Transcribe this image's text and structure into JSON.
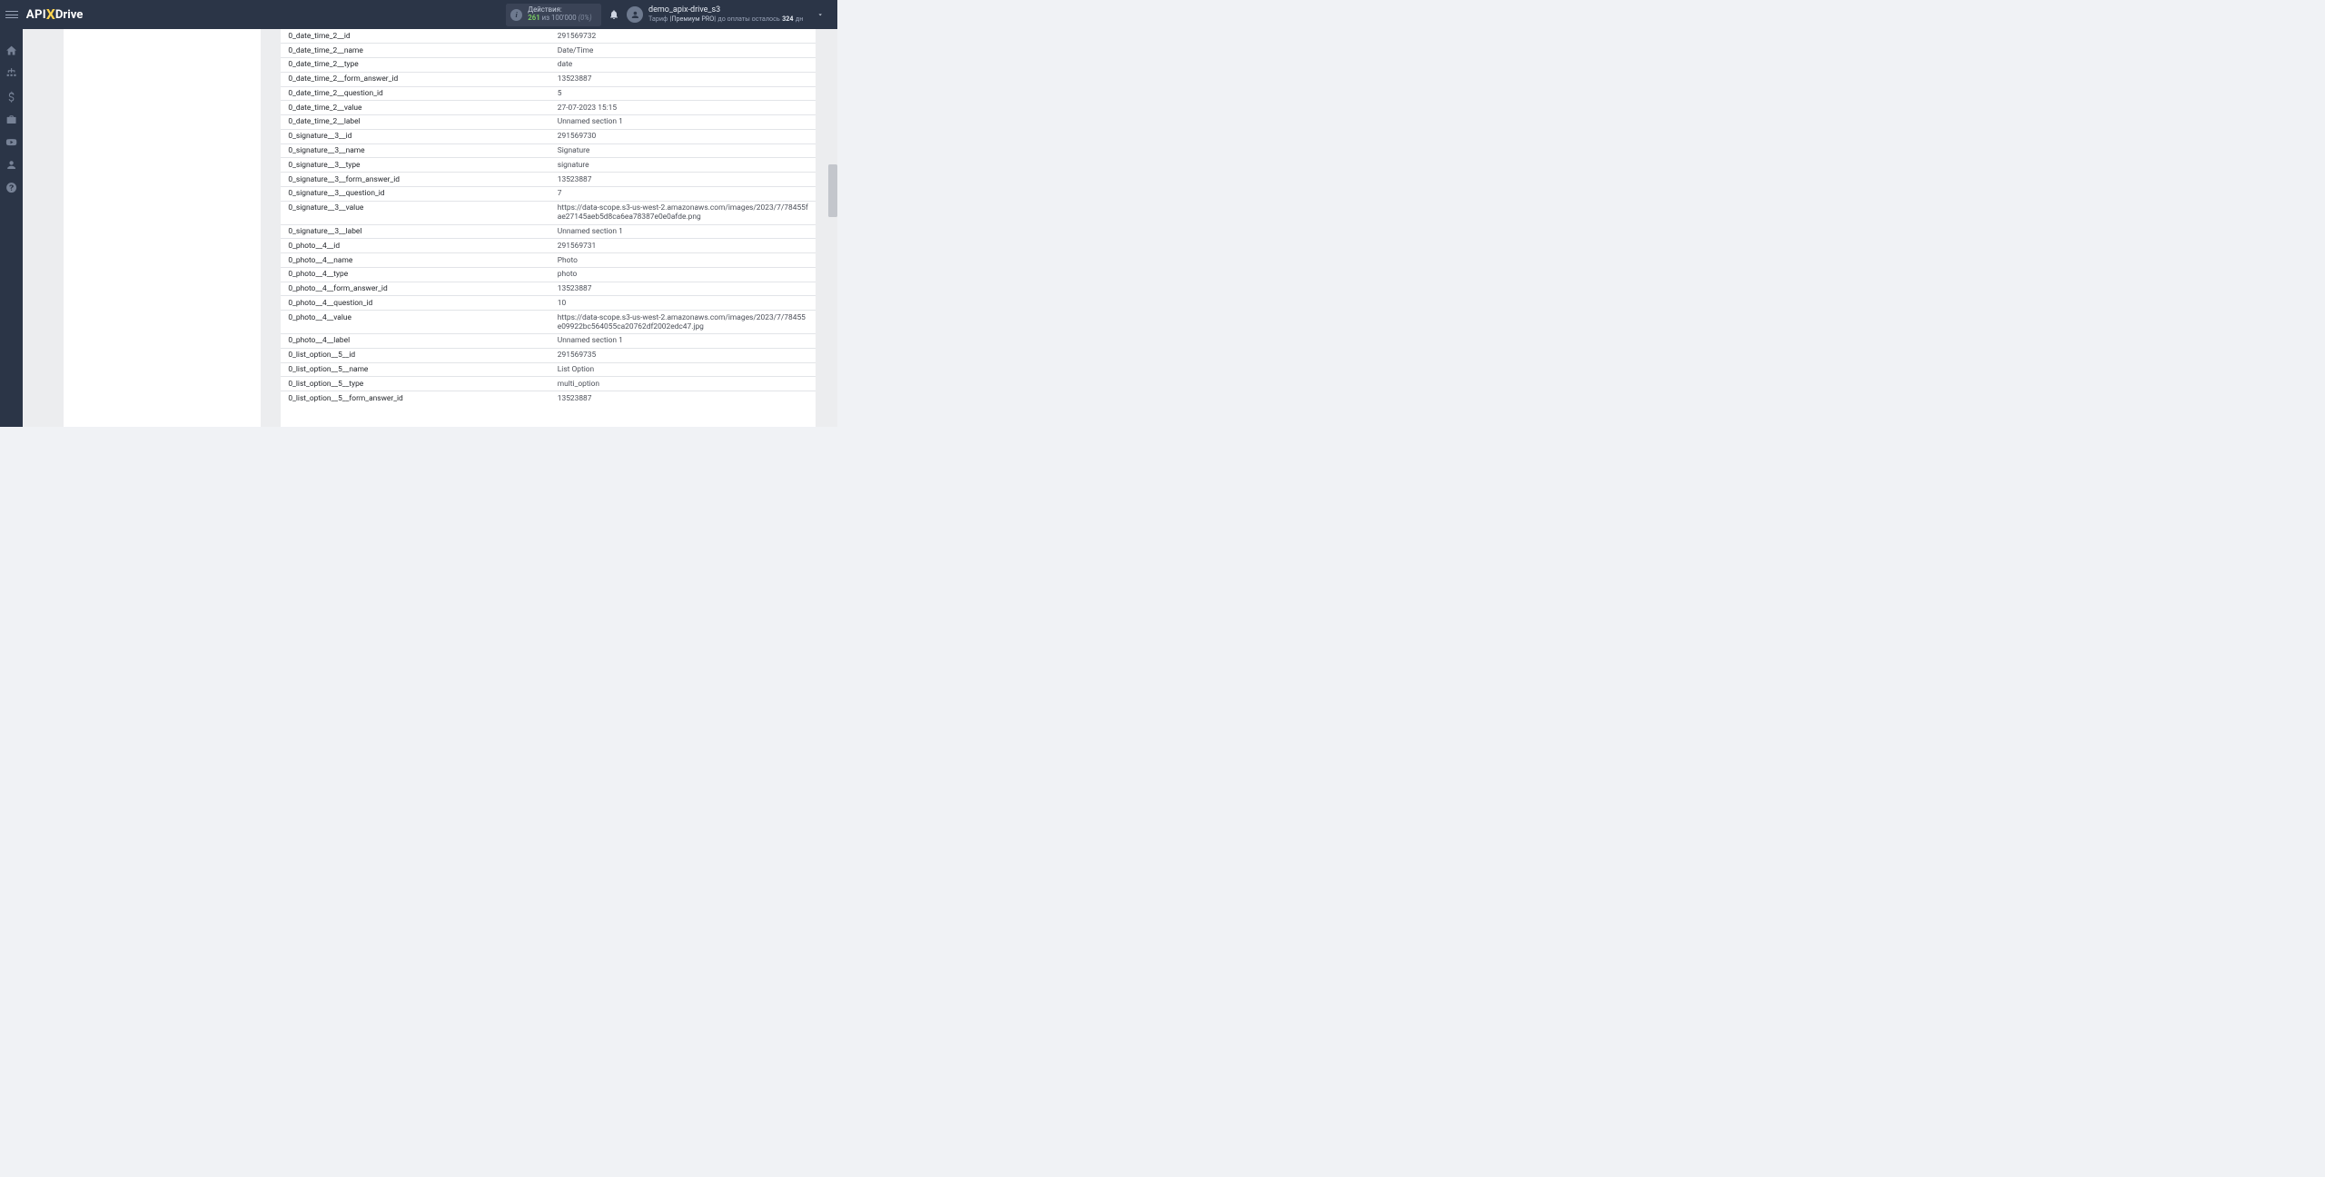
{
  "header": {
    "logo_part1": "API",
    "logo_part2": "X",
    "logo_part3": "Drive",
    "actions": {
      "label": "Действия:",
      "used": "261",
      "sep": "из",
      "limit": "100'000",
      "pct": "(0%)"
    },
    "user": {
      "name": "demo_apix-drive_s3",
      "tariff_label": "Тариф",
      "plan": "|Премиум PRO|",
      "pay_text": "до оплаты осталось",
      "days": "324",
      "days_suffix": "дн"
    }
  },
  "kv_rows": [
    {
      "k": "0_date_time_2__id",
      "v": "291569732"
    },
    {
      "k": "0_date_time_2__name",
      "v": "Date/Time"
    },
    {
      "k": "0_date_time_2__type",
      "v": "date"
    },
    {
      "k": "0_date_time_2__form_answer_id",
      "v": "13523887"
    },
    {
      "k": "0_date_time_2__question_id",
      "v": "5"
    },
    {
      "k": "0_date_time_2__value",
      "v": "27-07-2023 15:15"
    },
    {
      "k": "0_date_time_2__label",
      "v": "Unnamed section 1"
    },
    {
      "k": "0_signature__3__id",
      "v": "291569730"
    },
    {
      "k": "0_signature__3__name",
      "v": "Signature"
    },
    {
      "k": "0_signature__3__type",
      "v": "signature"
    },
    {
      "k": "0_signature__3__form_answer_id",
      "v": "13523887"
    },
    {
      "k": "0_signature__3__question_id",
      "v": "7"
    },
    {
      "k": "0_signature__3__value",
      "v": "https://data-scope.s3-us-west-2.amazonaws.com/images/2023/7/78455fae27145aeb5d8ca6ea78387e0e0afde.png"
    },
    {
      "k": "0_signature__3__label",
      "v": "Unnamed section 1"
    },
    {
      "k": "0_photo__4__id",
      "v": "291569731"
    },
    {
      "k": "0_photo__4__name",
      "v": "Photo"
    },
    {
      "k": "0_photo__4__type",
      "v": "photo"
    },
    {
      "k": "0_photo__4__form_answer_id",
      "v": "13523887"
    },
    {
      "k": "0_photo__4__question_id",
      "v": "10"
    },
    {
      "k": "0_photo__4__value",
      "v": "https://data-scope.s3-us-west-2.amazonaws.com/images/2023/7/78455e09922bc564055ca20762df2002edc47.jpg"
    },
    {
      "k": "0_photo__4__label",
      "v": "Unnamed section 1"
    },
    {
      "k": "0_list_option__5__id",
      "v": "291569735"
    },
    {
      "k": "0_list_option__5__name",
      "v": "List Option"
    },
    {
      "k": "0_list_option__5__type",
      "v": "multi_option"
    },
    {
      "k": "0_list_option__5__form_answer_id",
      "v": "13523887"
    }
  ]
}
